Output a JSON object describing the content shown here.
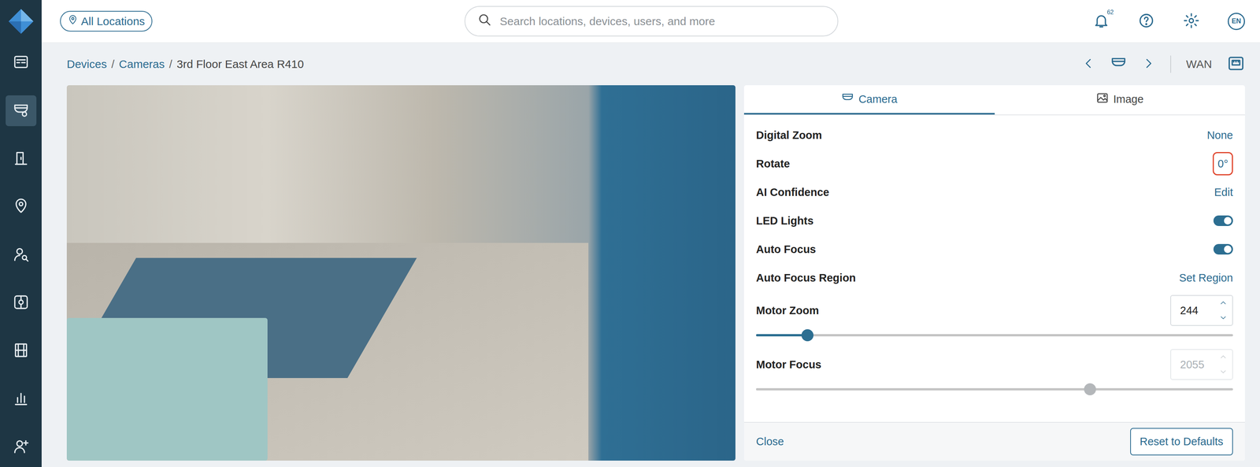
{
  "header": {
    "location_button": "All Locations",
    "search_placeholder": "Search locations, devices, users, and more",
    "notification_count": "62",
    "language": "EN"
  },
  "sidebar": {
    "items": [
      {
        "selected": false
      },
      {
        "selected": true
      },
      {
        "selected": false
      },
      {
        "selected": false
      },
      {
        "selected": false
      },
      {
        "selected": false
      },
      {
        "selected": false
      },
      {
        "selected": false
      },
      {
        "selected": false
      }
    ]
  },
  "breadcrumb": {
    "separator": "/",
    "items": [
      {
        "label": "Devices",
        "link": true
      },
      {
        "label": "Cameras",
        "link": true
      },
      {
        "label": "3rd Floor East Area R410",
        "link": false
      }
    ]
  },
  "nav": {
    "network": "WAN"
  },
  "tabs": [
    {
      "label": "Camera",
      "selected": true
    },
    {
      "label": "Image",
      "selected": false
    }
  ],
  "settings": [
    {
      "kind": "link",
      "label": "Digital Zoom",
      "value": "None",
      "highlighted": false
    },
    {
      "kind": "link",
      "label": "Rotate",
      "value": "0°",
      "highlighted": true
    },
    {
      "kind": "link",
      "label": "AI Confidence",
      "value": "Edit",
      "highlighted": false
    },
    {
      "kind": "toggle",
      "label": "LED Lights",
      "on": true
    },
    {
      "kind": "toggle",
      "label": "Auto Focus",
      "on": true
    },
    {
      "kind": "link",
      "label": "Auto Focus Region",
      "value": "Set Region",
      "highlighted": false
    },
    {
      "kind": "slider",
      "label": "Motor Zoom",
      "value": "244",
      "level": 0.108,
      "disabled": false
    },
    {
      "kind": "slider",
      "label": "Motor Focus",
      "value": "2055",
      "level": 0.7,
      "disabled": true
    }
  ],
  "footer": {
    "close": "Close",
    "reset": "Reset to Defaults"
  }
}
